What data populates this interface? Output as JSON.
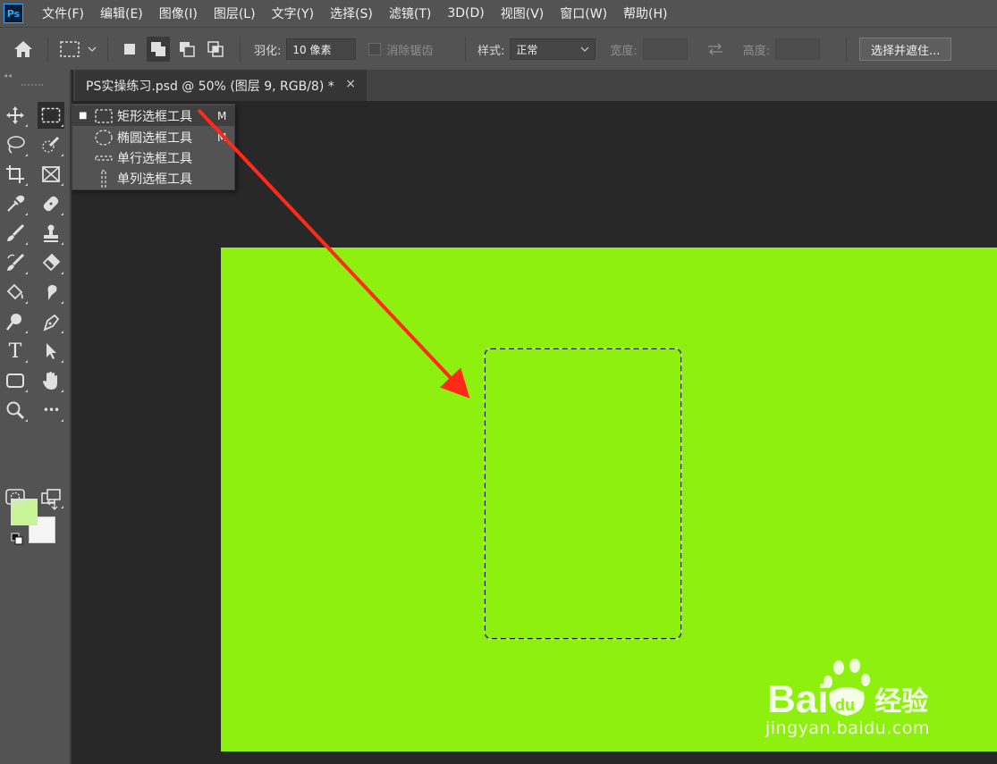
{
  "app": {
    "logo": "Ps"
  },
  "menu": [
    {
      "label": "文件(F)"
    },
    {
      "label": "编辑(E)"
    },
    {
      "label": "图像(I)"
    },
    {
      "label": "图层(L)"
    },
    {
      "label": "文字(Y)"
    },
    {
      "label": "选择(S)"
    },
    {
      "label": "滤镜(T)"
    },
    {
      "label": "3D(D)"
    },
    {
      "label": "视图(V)"
    },
    {
      "label": "窗口(W)"
    },
    {
      "label": "帮助(H)"
    }
  ],
  "options": {
    "feather_label": "羽化:",
    "feather_value": "10 像素",
    "antialias_label": "消除锯齿",
    "style_label": "样式:",
    "style_value": "正常",
    "width_label": "宽度:",
    "height_label": "高度:",
    "select_mask_label": "选择并遮住..."
  },
  "document": {
    "tab_title": "PS实操练习.psd @ 50% (图层 9, RGB/8) *",
    "close_glyph": "×",
    "canvas_color": "#8ef00e"
  },
  "tools": [
    {
      "icon": "move-icon"
    },
    {
      "icon": "rectangular-marquee-icon",
      "active": true
    },
    {
      "icon": "lasso-icon"
    },
    {
      "icon": "quick-selection-icon"
    },
    {
      "icon": "crop-icon"
    },
    {
      "icon": "frame-icon"
    },
    {
      "icon": "eyedropper-icon"
    },
    {
      "icon": "healing-brush-icon"
    },
    {
      "icon": "brush-icon"
    },
    {
      "icon": "clone-stamp-icon"
    },
    {
      "icon": "history-brush-icon"
    },
    {
      "icon": "eraser-icon"
    },
    {
      "icon": "paint-bucket-icon"
    },
    {
      "icon": "smudge-icon"
    },
    {
      "icon": "dodge-icon"
    },
    {
      "icon": "pen-icon"
    },
    {
      "icon": "type-icon",
      "glyph": "T"
    },
    {
      "icon": "path-selection-icon"
    },
    {
      "icon": "rectangle-shape-icon"
    },
    {
      "icon": "hand-icon"
    },
    {
      "icon": "zoom-icon"
    },
    {
      "icon": "more-tools-icon",
      "glyph": "•••"
    }
  ],
  "colors": {
    "foreground": "#c9f598",
    "background": "#f5f5f5"
  },
  "flyout": [
    {
      "label": "矩形选框工具",
      "shortcut": "M",
      "selected": true,
      "icon": "rect-marquee-icon"
    },
    {
      "label": "椭圆选框工具",
      "shortcut": "M",
      "selected": false,
      "icon": "ellipse-marquee-icon"
    },
    {
      "label": "单行选框工具",
      "shortcut": "",
      "selected": false,
      "icon": "single-row-marquee-icon"
    },
    {
      "label": "单列选框工具",
      "shortcut": "",
      "selected": false,
      "icon": "single-column-marquee-icon"
    }
  ],
  "watermark": {
    "brand": "Bai",
    "brand2": "du",
    "cn": "经验",
    "url": "jingyan.baidu.com"
  }
}
